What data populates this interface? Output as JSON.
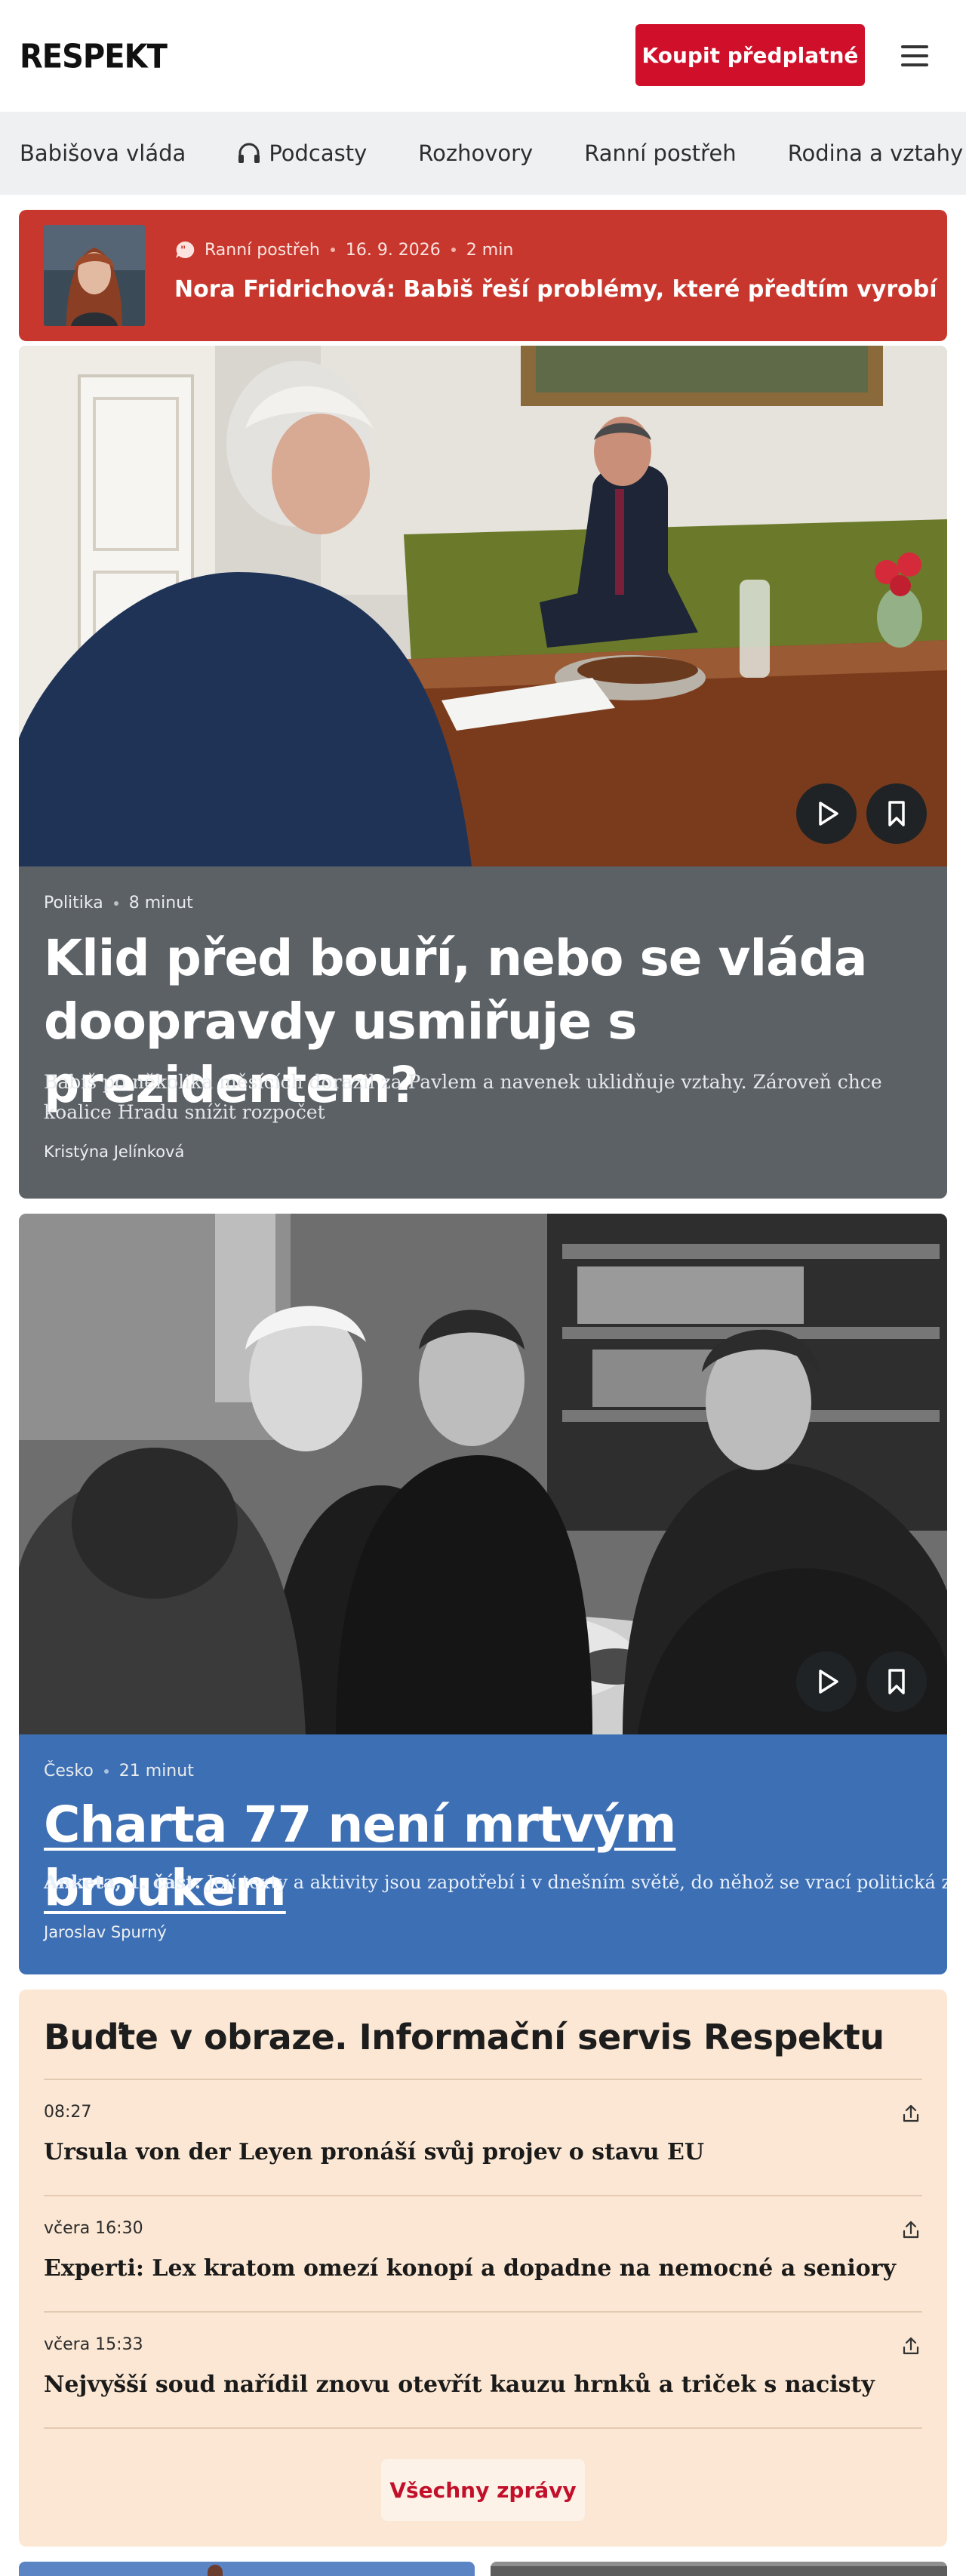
{
  "header": {
    "logo": "RESPEKT",
    "subscribe_label": "Koupit předplatné"
  },
  "nav": {
    "items": [
      {
        "label": "Babišova vláda"
      },
      {
        "label": "Podcasty",
        "icon": "headphones-icon"
      },
      {
        "label": "Rozhovory"
      },
      {
        "label": "Ranní postřeh"
      },
      {
        "label": "Rodina a vztahy"
      }
    ]
  },
  "promo": {
    "category": "Ranní postřeh",
    "date": "16. 9. 2026",
    "duration": "2 min",
    "title": "Nora Fridrichová: Babiš řeší problémy, které předtím vyrobí",
    "icon": "quote-bubble-icon"
  },
  "articles": [
    {
      "category": "Politika",
      "duration": "8 minut",
      "title": "Klid před bouří, nebo se vláda doopravdy usmiřuje s prezidentem?",
      "perex": "Babiš po několika měsících dorazil za Pavlem a navenek uklidňuje vztahy. Zároveň chce koalice Hradu snížit rozpočet",
      "author": "Kristýna Jelínková",
      "bg_color": "#5c6166"
    },
    {
      "category": "Česko",
      "duration": "21 minut",
      "title": "Charta 77 není mrtvým broukem",
      "perex_lead": "Anketa, 1. část:",
      "perex": "Její texty a aktivity jsou zapotřebí i v dnešním světě, do něhož se vrací politická zvůle",
      "author": "Jaroslav Spurný",
      "bg_color": "#3d6fb4"
    }
  ],
  "news": {
    "heading": "Buďte v obraze. Informační servis Respektu",
    "items": [
      {
        "time": "08:27",
        "title": "Ursula von der Leyen pronáší svůj projev o stavu EU"
      },
      {
        "time": "včera 16:30",
        "title": "Experti: Lex kratom omezí konopí a dopadne na nemocné a seniory"
      },
      {
        "time": "včera 15:33",
        "title": "Nejvyšší soud nařídil znovu otevřít kauzu hrnků a triček s nacisty"
      }
    ],
    "all_label": "Všechny zprávy"
  },
  "colors": {
    "brand_red": "#d0102a",
    "promo_red": "#c8372d",
    "news_bg": "#fbe7d3"
  }
}
